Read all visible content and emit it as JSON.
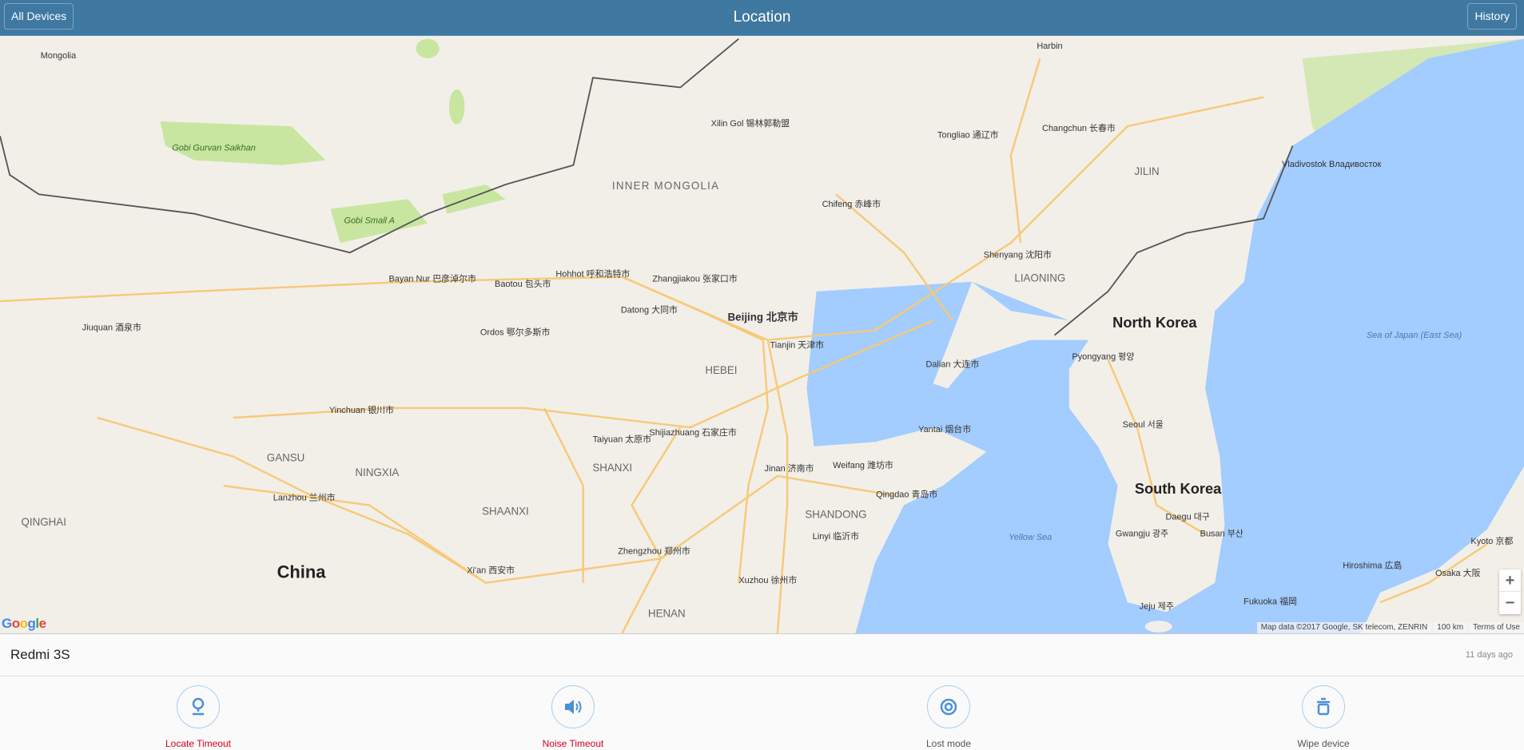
{
  "header": {
    "left_button": "All Devices",
    "title": "Location",
    "right_button": "History"
  },
  "map": {
    "labels": [
      "Mongolia",
      "Gobi Gurvan Saikhan",
      "Gobi Small A",
      "INNER MONGOLIA",
      "Xilin Gol 锡林郭勒盟",
      "Hohhot 呼和浩特市",
      "Baotou 包头市",
      "Bayan Nur 巴彦淖尔市",
      "Ordos 鄂尔多斯市",
      "Datong 大同市",
      "Zhangjiakou 张家口市",
      "Beijing 北京市",
      "Tianjin 天津市",
      "HEBEI",
      "Shijiazhuang 石家庄市",
      "Taiyuan 太原市",
      "SHANXI",
      "Jinan 济南市",
      "Qingdao 青岛市",
      "SHANDONG",
      "Zhengzhou 郑州市",
      "HENAN",
      "Xi'an 西安市",
      "SHAANXI",
      "Lanzhou 兰州市",
      "GANSU",
      "NINGXIA",
      "Yinchuan 银川市",
      "QINGHAI",
      "China",
      "Shenyang 沈阳市",
      "LIAONING",
      "Dalian 大连市",
      "Changchun 长春市",
      "JILIN",
      "Harbin",
      "Vladivostok Владивосток",
      "North Korea",
      "Pyongyang 평양",
      "Seoul 서울",
      "South Korea",
      "Busan 부산",
      "Daegu 대구",
      "Gwangju 광주",
      "Jeju 제주",
      "Sea of Japan (East Sea)",
      "Yellow Sea",
      "Fukuoka 福岡",
      "Hiroshima 広島",
      "Osaka 大阪",
      "Kyoto 京都",
      "Yantai 烟台市",
      "Xuzhou 徐州市",
      "Linyi 临沂市",
      "Weifang 潍坊市",
      "Chifeng 赤峰市",
      "Tongliao 通辽市",
      "Jiuquan 酒泉市"
    ],
    "zoom_in": "+",
    "zoom_out": "−",
    "attribution": "Map data ©2017 Google, SK telecom, ZENRIN",
    "scale": "100 km",
    "terms": "Terms of Use",
    "logo": "Google",
    "colors": {
      "land": "#f2efe9",
      "water": "#a3ccff",
      "road": "#f7c978",
      "park": "#c8e6a0",
      "border": "#555555"
    }
  },
  "device": {
    "name": "Redmi 3S",
    "last_seen": "11 days ago"
  },
  "actions": [
    {
      "label": "Locate Timeout",
      "icon": "location-pin-icon",
      "status": "error"
    },
    {
      "label": "Noise Timeout",
      "icon": "speaker-icon",
      "status": "error"
    },
    {
      "label": "Lost mode",
      "icon": "target-icon",
      "status": "normal"
    },
    {
      "label": "Wipe device",
      "icon": "trash-icon",
      "status": "normal"
    }
  ]
}
